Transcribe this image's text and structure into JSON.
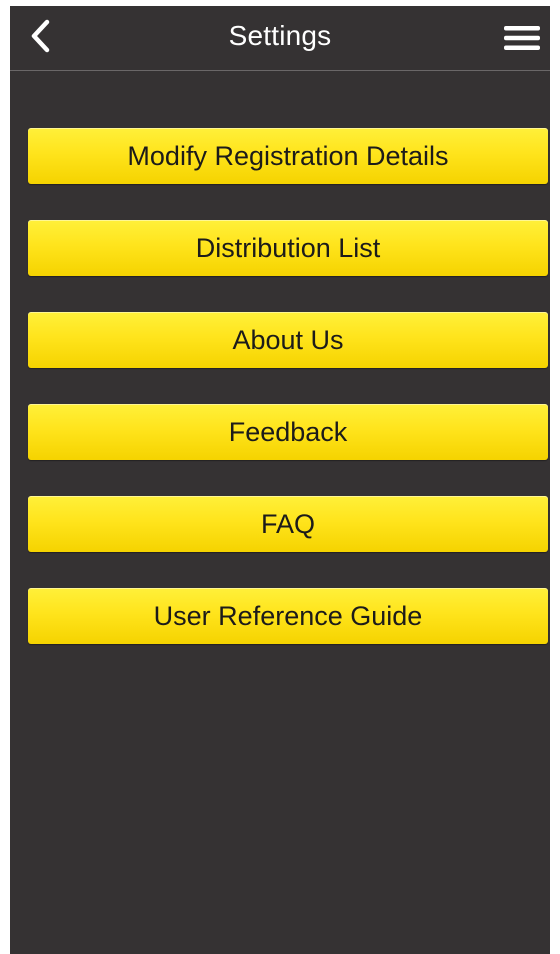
{
  "header": {
    "title": "Settings",
    "back_icon": "chevron-left-icon",
    "menu_icon": "hamburger-menu-icon"
  },
  "menu": {
    "items": [
      {
        "label": "Modify Registration Details"
      },
      {
        "label": "Distribution List"
      },
      {
        "label": "About Us"
      },
      {
        "label": "Feedback"
      },
      {
        "label": "FAQ"
      },
      {
        "label": "User Reference Guide"
      }
    ]
  },
  "colors": {
    "background": "#353233",
    "button_yellow": "#ffe41c",
    "title_text": "#ffffff",
    "button_text": "#1c1b1a"
  }
}
